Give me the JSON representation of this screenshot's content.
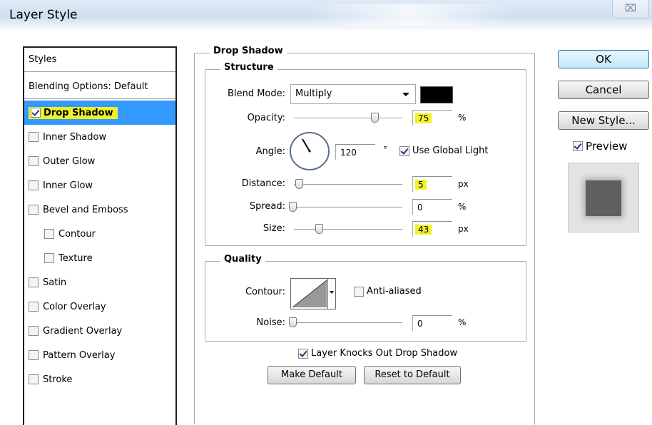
{
  "window": {
    "title": "Layer Style",
    "close_glyph": "⌧"
  },
  "styles_panel": {
    "header": "Styles",
    "blending_options": "Blending Options: Default",
    "items": [
      {
        "label": "Drop Shadow",
        "checked": true,
        "selected": true
      },
      {
        "label": "Inner Shadow",
        "checked": false
      },
      {
        "label": "Outer Glow",
        "checked": false
      },
      {
        "label": "Inner Glow",
        "checked": false
      },
      {
        "label": "Bevel and Emboss",
        "checked": false
      },
      {
        "label": "Contour",
        "checked": false,
        "indent": true
      },
      {
        "label": "Texture",
        "checked": false,
        "indent": true
      },
      {
        "label": "Satin",
        "checked": false
      },
      {
        "label": "Color Overlay",
        "checked": false
      },
      {
        "label": "Gradient Overlay",
        "checked": false
      },
      {
        "label": "Pattern Overlay",
        "checked": false
      },
      {
        "label": "Stroke",
        "checked": false
      }
    ]
  },
  "drop_shadow": {
    "title": "Drop Shadow",
    "structure": {
      "title": "Structure",
      "blend_mode_label": "Blend Mode:",
      "blend_mode_value": "Multiply",
      "shadow_color": "#000000",
      "opacity_label": "Opacity:",
      "opacity_value": "75",
      "opacity_unit": "%",
      "angle_label": "Angle:",
      "angle_value": "120",
      "angle_unit": "°",
      "use_global_light_label": "Use Global Light",
      "use_global_light_checked": true,
      "distance_label": "Distance:",
      "distance_value": "5",
      "distance_unit": "px",
      "spread_label": "Spread:",
      "spread_value": "0",
      "spread_unit": "%",
      "size_label": "Size:",
      "size_value": "43",
      "size_unit": "px"
    },
    "quality": {
      "title": "Quality",
      "contour_label": "Contour:",
      "anti_aliased_label": "Anti-aliased",
      "anti_aliased_checked": false,
      "noise_label": "Noise:",
      "noise_value": "0",
      "noise_unit": "%"
    },
    "layer_knocks_out_label": "Layer Knocks Out Drop Shadow",
    "layer_knocks_out_checked": true,
    "make_default_label": "Make Default",
    "reset_default_label": "Reset to Default"
  },
  "buttons": {
    "ok": "OK",
    "cancel": "Cancel",
    "new_style": "New Style...",
    "preview_label": "Preview",
    "preview_checked": true
  },
  "colors": {
    "selection_blue": "#3399ff",
    "highlight_yellow": "#f2f22a"
  }
}
